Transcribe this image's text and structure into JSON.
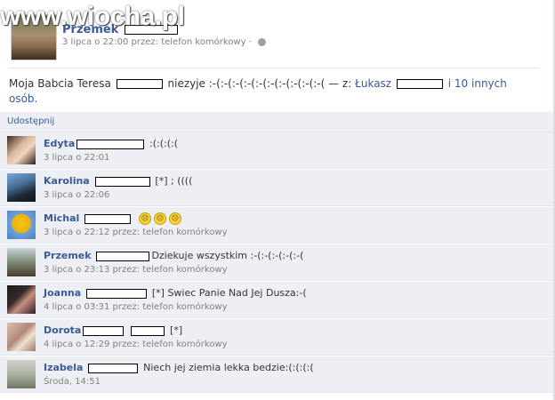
{
  "watermark": {
    "text": "www.wiocha.pl"
  },
  "post": {
    "author": "Przemek",
    "meta": "3 lipca o 22:00 przez: telefon komórkowy · ",
    "status_prefix": "Moja Babcia Teresa",
    "status_middle": "niezyje :-(:-(:-(:-(:-(:-(:-(:-(:-(:-( — z:",
    "tagged": "Łukasz",
    "others": "i 10 innych osób."
  },
  "share": {
    "label": "Udostępnij"
  },
  "comments": [
    {
      "name": "Edyta",
      "text": ":(:(:(:(",
      "time": "3 lipca o 22:01",
      "emoticons": 0
    },
    {
      "name": "Karolina",
      "text": "[*] ; ((((",
      "time": "3 lipca o 22:06",
      "emoticons": 0
    },
    {
      "name": "Michal",
      "text": "",
      "time": "3 lipca o 22:12 przez: telefon komórkowy",
      "emoticons": 3
    },
    {
      "name": "Przemek",
      "text": "Dziekuje wszystkim :-(:-(:-(:-(:-(",
      "time": "3 lipca o 23:13 przez: telefon komórkowy",
      "emoticons": 0
    },
    {
      "name": "Joanna",
      "text": "[*] Swiec Panie Nad Jej Dusza:-(",
      "time": "4 lipca o 03:31 przez: telefon komórkowy",
      "emoticons": 0
    },
    {
      "name": "Dorota",
      "text": "[*]",
      "time": "4 lipca o 12:29 przez: telefon komórkowy",
      "emoticons": 0
    },
    {
      "name": "Izabela",
      "text": "Niech jej ziemia lekka bedzie:(:(:(:(",
      "time": "Środa, 14:51",
      "emoticons": 0
    }
  ],
  "colors": {
    "link": "#3b5998",
    "comment_bg": "#edeff4",
    "meta": "#808080"
  },
  "icons": {
    "emoticon": "sad-face-emoticon",
    "privacy": "globe-icon"
  }
}
